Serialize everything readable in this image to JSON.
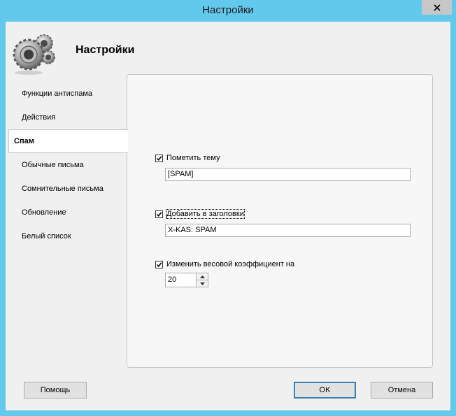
{
  "window": {
    "title": "Настройки"
  },
  "header": {
    "title": "Настройки",
    "icon": "gears-icon"
  },
  "nav": {
    "items": [
      {
        "label": "Функции антиспама",
        "active": false
      },
      {
        "label": "Действия",
        "active": false
      },
      {
        "label": "Спам",
        "active": true
      },
      {
        "label": "Обычные письма",
        "active": false
      },
      {
        "label": "Сомнительные письма",
        "active": false
      },
      {
        "label": "Обновление",
        "active": false
      },
      {
        "label": "Белый список",
        "active": false
      }
    ]
  },
  "spam": {
    "mark_subject": {
      "label": "Пометить тему",
      "checked": true,
      "value": "[SPAM]"
    },
    "add_header": {
      "label": "Добавить в заголовки",
      "checked": true,
      "value": "X-KAS: SPAM"
    },
    "change_weight": {
      "label": "Изменить весовой коэффициент на",
      "checked": true,
      "value": "20"
    }
  },
  "buttons": {
    "help": "Помощь",
    "ok": "OK",
    "cancel": "Отмена"
  },
  "colors": {
    "titlebar": "#62c9ec",
    "client": "#f0f0f0",
    "panel": "#f7f7f7",
    "default_button_border": "#3c7fb1"
  }
}
